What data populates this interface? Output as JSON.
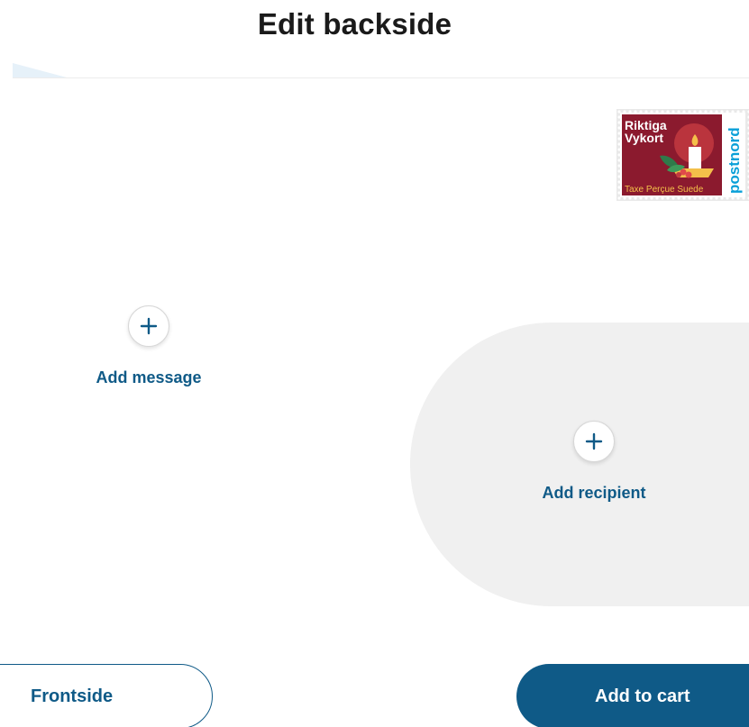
{
  "header": {
    "title": "Edit backside"
  },
  "stamp": {
    "title_line1": "Riktiga",
    "title_line2": "Vykort",
    "footer_text": "Taxe Perçue Suede",
    "brand": "postnord",
    "colors": {
      "background": "#8b1a2e",
      "brand_blue": "#0aa0d8",
      "candle_glow": "#e04a4a",
      "accent_yellow": "#f4c04a"
    }
  },
  "message": {
    "icon": "plus-icon",
    "label": "Add message"
  },
  "recipient": {
    "icon": "plus-icon",
    "label": "Add recipient"
  },
  "footer": {
    "frontside_label": "Frontside",
    "add_to_cart_label": "Add to cart"
  },
  "colors": {
    "primary": "#0f5a87",
    "panel_gray": "#f0f0f0",
    "title_text": "#1a1a1a"
  }
}
